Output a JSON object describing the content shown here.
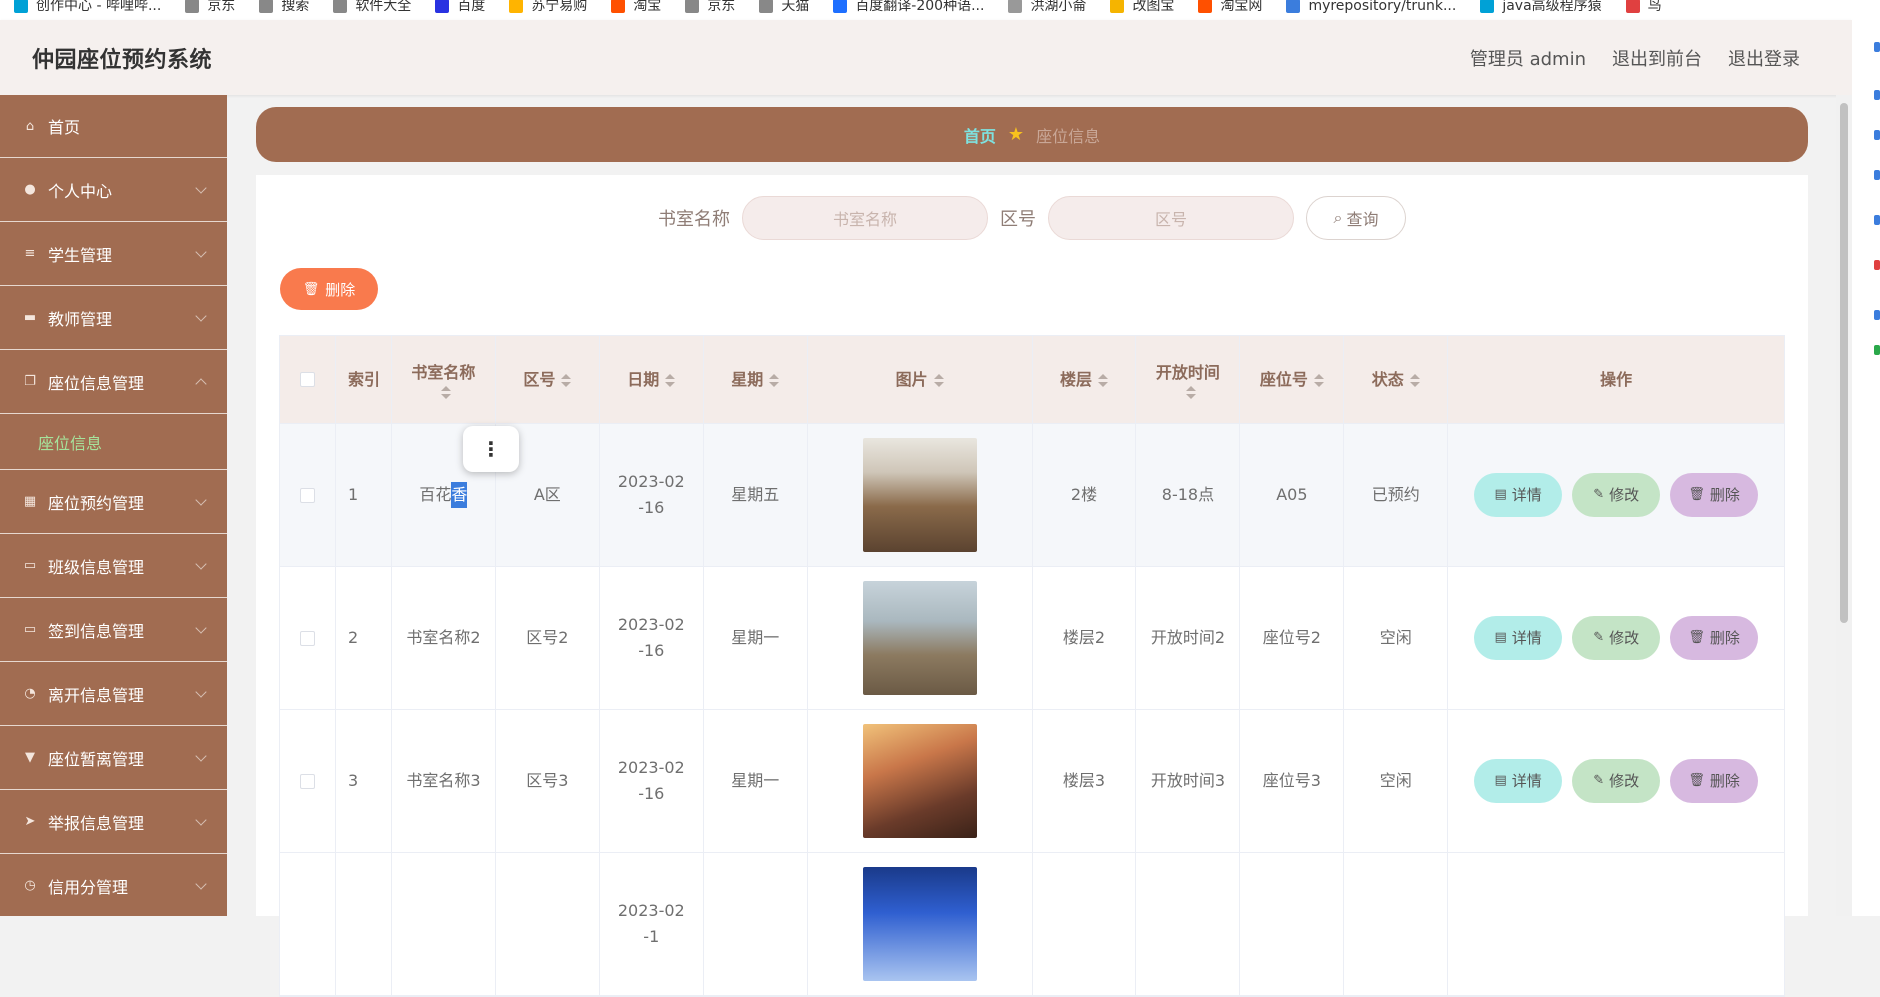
{
  "bookmarks": [
    {
      "label": "创作中心 - 哔哩哔...",
      "icon": "bilibili-icon",
      "color": "#00a1d6"
    },
    {
      "label": "京东",
      "icon": "page-icon",
      "color": "#888888"
    },
    {
      "label": "搜索",
      "icon": "page-icon",
      "color": "#888888"
    },
    {
      "label": "软件大全",
      "icon": "page-icon",
      "color": "#888888"
    },
    {
      "label": "百度",
      "icon": "baidu-icon",
      "color": "#2932e1"
    },
    {
      "label": "苏宁易购",
      "icon": "suning-icon",
      "color": "#ffb400"
    },
    {
      "label": "淘宝",
      "icon": "taobao-icon",
      "color": "#ff5000"
    },
    {
      "label": "京东",
      "icon": "page-icon",
      "color": "#888888"
    },
    {
      "label": "天猫",
      "icon": "page-icon",
      "color": "#888888"
    },
    {
      "label": "百度翻译-200种语...",
      "icon": "translate-icon",
      "color": "#1e6fff"
    },
    {
      "label": "洪湖小侖",
      "icon": "bird-icon",
      "color": "#999999"
    },
    {
      "label": "改图宝",
      "icon": "folder-icon",
      "color": "#f5b400"
    },
    {
      "label": "淘宝网",
      "icon": "taobao-icon",
      "color": "#ff5000"
    },
    {
      "label": "myrepository/trunk...",
      "icon": "chrome-icon",
      "color": "#3b7ddd"
    },
    {
      "label": "java高级程序猿",
      "icon": "bilibili-icon",
      "color": "#00a1d6"
    },
    {
      "label": "鸟",
      "icon": "bird-icon",
      "color": "#e04040"
    }
  ],
  "header": {
    "title": "仲园座位预约系统",
    "user": "管理员 admin",
    "front": "退出到前台",
    "logout": "退出登录"
  },
  "sidebar": {
    "items": [
      {
        "label": "首页",
        "icon": "home-icon",
        "chevron": false
      },
      {
        "label": "个人中心",
        "icon": "user-icon",
        "chevron": true
      },
      {
        "label": "学生管理",
        "icon": "list-icon",
        "chevron": true
      },
      {
        "label": "教师管理",
        "icon": "chat-icon",
        "chevron": true
      },
      {
        "label": "座位信息管理",
        "icon": "copy-icon",
        "chevron": true,
        "expanded": true
      },
      {
        "label": "座位预约管理",
        "icon": "grid-icon",
        "chevron": true
      },
      {
        "label": "班级信息管理",
        "icon": "monitor-icon",
        "chevron": true
      },
      {
        "label": "签到信息管理",
        "icon": "monitor-icon",
        "chevron": true
      },
      {
        "label": "离开信息管理",
        "icon": "compass-icon",
        "chevron": true
      },
      {
        "label": "座位暂离管理",
        "icon": "stamp-icon",
        "chevron": true
      },
      {
        "label": "举报信息管理",
        "icon": "send-icon",
        "chevron": true
      },
      {
        "label": "信用分管理",
        "icon": "clock-icon",
        "chevron": true
      }
    ],
    "submenu_active": "座位信息",
    "active_color": "#a6e39c"
  },
  "breadcrumb": {
    "home": "首页",
    "current": "座位信息"
  },
  "search": {
    "room_label": "书室名称",
    "room_placeholder": "书室名称",
    "zone_label": "区号",
    "zone_placeholder": "区号",
    "query_label": "查询"
  },
  "toolbar": {
    "delete_label": "删除"
  },
  "table": {
    "headers": [
      "索引",
      "书室名称",
      "区号",
      "日期",
      "星期",
      "图片",
      "楼层",
      "开放时间",
      "座位号",
      "状态",
      "操作"
    ],
    "rows": [
      {
        "index": "1",
        "room_pre": "百花",
        "room_sel": "香",
        "zone": "A区",
        "date": "2023-02-16",
        "weekday": "星期五",
        "image": "classroom-photo-1",
        "floor": "2楼",
        "open": "8-18点",
        "seat": "A05",
        "status": "已预约"
      },
      {
        "index": "2",
        "room": "书室名称2",
        "zone": "区号2",
        "date": "2023-02-16",
        "weekday": "星期一",
        "image": "classroom-photo-2",
        "floor": "楼层2",
        "open": "开放时间2",
        "seat": "座位号2",
        "status": "空闲"
      },
      {
        "index": "3",
        "room": "书室名称3",
        "zone": "区号3",
        "date": "2023-02-16",
        "weekday": "星期一",
        "image": "classroom-photo-3",
        "floor": "楼层3",
        "open": "开放时间3",
        "seat": "座位号3",
        "status": "空闲"
      },
      {
        "date": "2023-02-1",
        "image": "classroom-photo-4"
      }
    ],
    "actions": {
      "detail": "详情",
      "edit": "修改",
      "remove": "删除"
    }
  },
  "colors": {
    "sidebar": "#a16c51",
    "accent_orange": "#f97a4d",
    "detail": "#b2ede9",
    "edit": "#c4e4c6",
    "remove": "#d7b9e0"
  }
}
